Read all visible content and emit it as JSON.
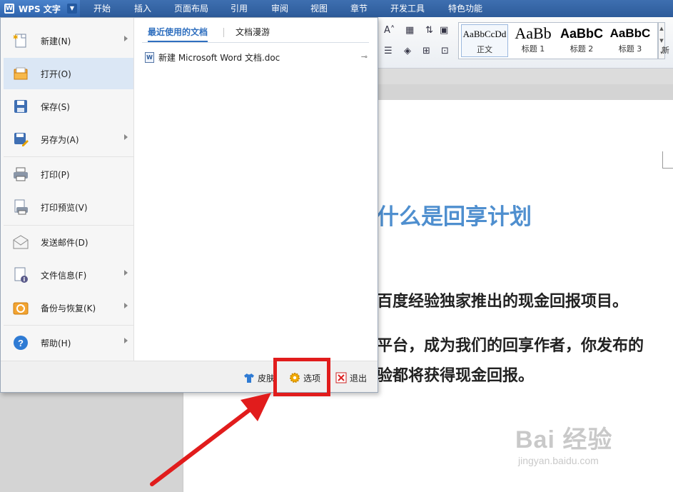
{
  "app": {
    "title": "WPS 文字"
  },
  "menu_tabs": [
    "开始",
    "插入",
    "页面布局",
    "引用",
    "审阅",
    "视图",
    "章节",
    "开发工具",
    "特色功能"
  ],
  "styles": {
    "samples": [
      "AaBbCcDd",
      "AaBb",
      "AaBbC",
      "AaBbC"
    ],
    "names": [
      "正文",
      "标题 1",
      "标题 2",
      "标题 3"
    ],
    "new_style": "新"
  },
  "app_menu": {
    "items": [
      {
        "label": "新建(N)",
        "icon": "new-doc-icon"
      },
      {
        "label": "打开(O)",
        "icon": "open-folder-icon"
      },
      {
        "label": "保存(S)",
        "icon": "save-icon"
      },
      {
        "label": "另存为(A)",
        "icon": "save-as-icon"
      },
      {
        "label": "打印(P)",
        "icon": "printer-icon"
      },
      {
        "label": "打印预览(V)",
        "icon": "print-preview-icon"
      },
      {
        "label": "发送邮件(D)",
        "icon": "mail-icon"
      },
      {
        "label": "文件信息(F)",
        "icon": "file-info-icon"
      },
      {
        "label": "备份与恢复(K)",
        "icon": "backup-restore-icon"
      },
      {
        "label": "帮助(H)",
        "icon": "help-icon"
      }
    ],
    "tabs": [
      "最近使用的文档",
      "文档漫游"
    ],
    "recent_docs": [
      "新建 Microsoft Word 文档.doc"
    ],
    "bottom": {
      "skin": "皮肤",
      "options": "选项",
      "exit": "退出"
    }
  },
  "document": {
    "heading": "什么是回享计划",
    "lines": [
      "百度经验独家推出的现金回报项目。",
      "平台，成为我们的回享作者，你发布的",
      "验都将获得现金回报。"
    ]
  },
  "watermark": {
    "main": "Bai 经验",
    "sub": "jingyan.baidu.com"
  },
  "colors": {
    "accent": "#2f6fbf",
    "annotation": "#e11c1c",
    "heading": "#4f8fcf"
  }
}
